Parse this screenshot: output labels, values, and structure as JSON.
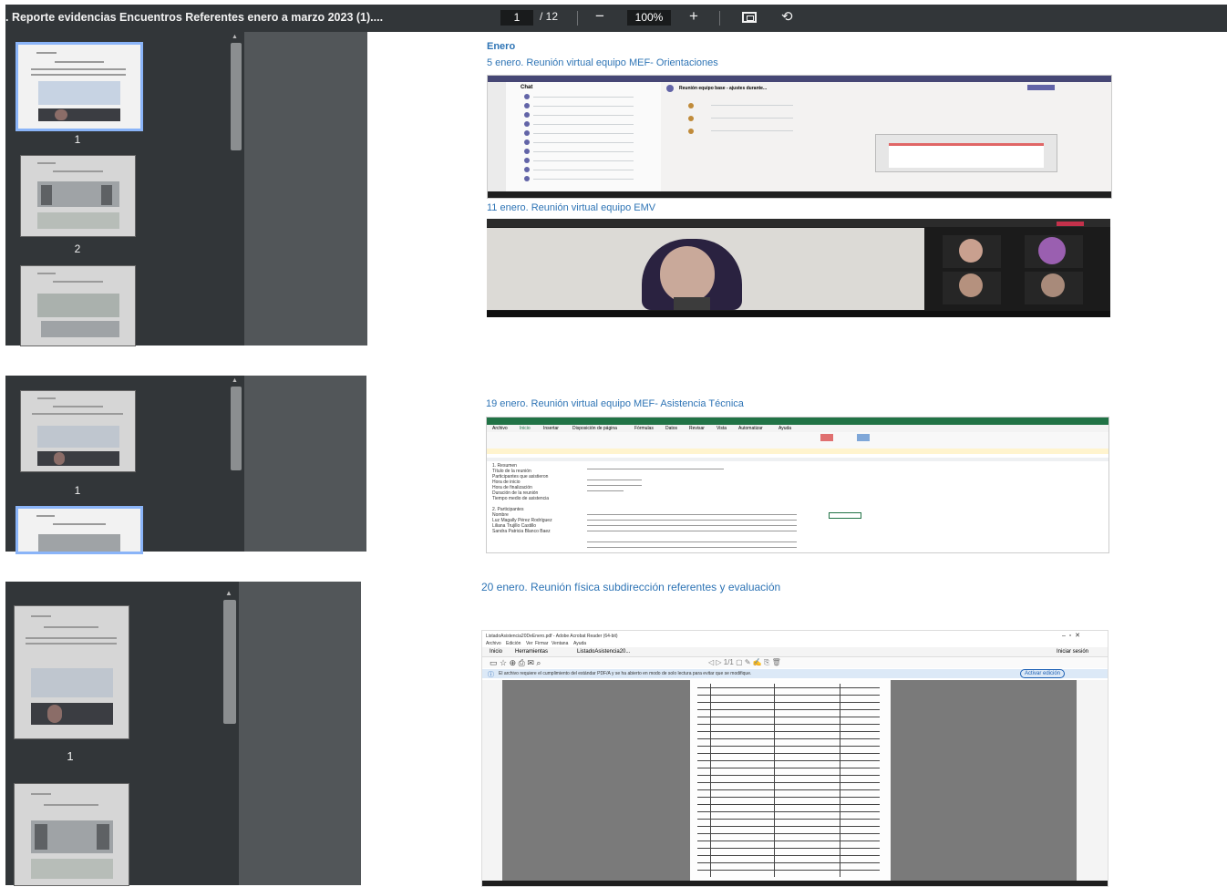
{
  "toolbar": {
    "title": ". Reporte evidencias Encuentros Referentes enero a marzo 2023 (1)....",
    "page_current": "1",
    "page_total": "/ 12",
    "zoom": "100%"
  },
  "panel1": {
    "thumb_numbers": [
      "1",
      "2"
    ],
    "month_heading": "Enero",
    "section1_title": "5 enero. Reunión virtual equipo MEF- Orientaciones",
    "section2_title": "11 enero. Reunión virtual equipo EMV",
    "teams": {
      "chat_header": "Chat",
      "meeting_title": "Reunión equipo base - ajustes durante..."
    }
  },
  "panel2": {
    "thumb_numbers": [
      "1"
    ],
    "section_title": "19 enero. Reunión virtual equipo MEF- Asistencia Técnica",
    "excel_tabs": [
      "Archivo",
      "Inicio",
      "Insertar",
      "Disposición de página",
      "Fórmulas",
      "Datos",
      "Revisar",
      "Vista",
      "Automatizar",
      "Ayuda"
    ],
    "excel_rows": [
      "1. Resumen",
      "Título de la reunión",
      "Participantes que asistieron",
      "Hora de inicio",
      "Hora de finalización",
      "Duración de la reunión",
      "Tiempo medio de asistencia",
      "",
      "2. Participantes",
      "Nombre",
      "Luz Magally Pérez Rodríguez",
      "Liliana Trujillo Castillo",
      "Sandra Patricia Blanco Baez"
    ]
  },
  "panel3": {
    "thumb_numbers": [
      "1"
    ],
    "section_title": "20 enero. Reunión física subdirección referentes y evaluación",
    "acrobat": {
      "window_title": "ListadoAsistencia20DeEnero.pdf - Adobe Acrobat Reader (64-bit)",
      "menu": [
        "Archivo",
        "Edición",
        "Ver",
        "Firmar",
        "Ventana",
        "Ayuda"
      ],
      "tabs": [
        "Inicio",
        "Herramientas",
        "ListadoAsistencia20..."
      ],
      "signin": "Iniciar sesión",
      "notice": "El archivo requiere el cumplimiento del estándar PDF/A y se ha abierto en modo de solo lectura para evitar que se modifique.",
      "edit_button": "Activar edición"
    }
  },
  "colors": {
    "toolbar_bg": "#323639",
    "viewer_bg": "#525659",
    "heading_blue": "#2e74b5",
    "selected_thumb": "#8ab4f8"
  }
}
